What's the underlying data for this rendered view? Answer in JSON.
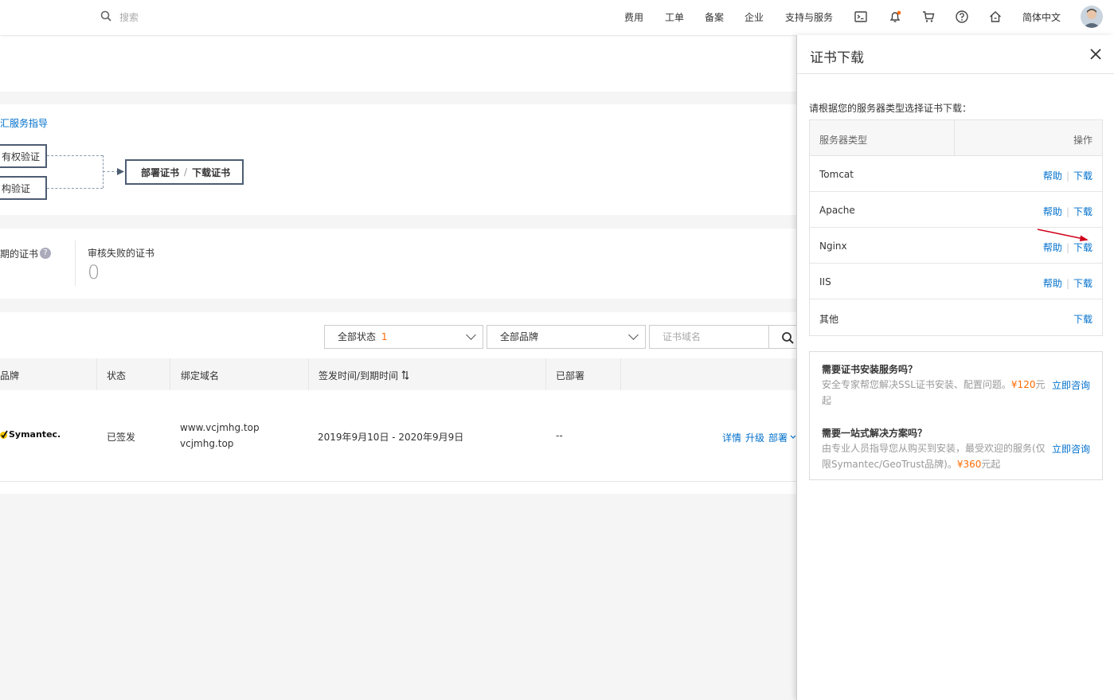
{
  "topbar": {
    "search_placeholder": "搜索",
    "nav": [
      "费用",
      "工单",
      "备案",
      "企业",
      "支持与服务"
    ],
    "language": "简体中文",
    "icons": [
      "terminal-icon",
      "bell-icon",
      "cart-icon",
      "help-circle-icon",
      "home-icon"
    ]
  },
  "guide": {
    "link": "汇服务指导",
    "box_ownership": "有权验证",
    "box_org": "构验证",
    "box_deploy": "部署证书",
    "box_download": "下载证书"
  },
  "stats": {
    "expired_label": "期的证书",
    "failed_label": "审核失败的证书",
    "failed_count": "0"
  },
  "filters": {
    "status_label": "全部状态",
    "status_count": "1",
    "brand_label": "全部品牌",
    "domain_placeholder": "证书域名"
  },
  "table": {
    "headers": [
      "品牌",
      "状态",
      "绑定域名",
      "签发时间/到期时间",
      "已部署"
    ],
    "rows": [
      {
        "brand": "Symantec.",
        "status": "已签发",
        "domains": [
          "www.vcjmhg.top",
          "vcjmhg.top"
        ],
        "period": "2019年9月10日 - 2020年9月9日",
        "deployed": "--",
        "actions": [
          "详情",
          "升级",
          "部署"
        ]
      }
    ]
  },
  "panel": {
    "title": "证书下载",
    "intro": "请根据您的服务器类型选择证书下载：",
    "col_server": "服务器类型",
    "col_action": "操作",
    "help_label": "帮助",
    "download_label": "下载",
    "servers": [
      {
        "name": "Tomcat",
        "has_help": true
      },
      {
        "name": "Apache",
        "has_help": true
      },
      {
        "name": "Nginx",
        "has_help": true
      },
      {
        "name": "IIS",
        "has_help": true
      },
      {
        "name": "其他",
        "has_help": false
      }
    ],
    "promo1": {
      "title": "需要证书安装服务吗？",
      "desc_a": "安全专家帮您解决SSL证书安装、配置问题。",
      "price": "¥120",
      "desc_b": "元起",
      "link": "立即咨询"
    },
    "promo2": {
      "title": "需要一站式解决方案吗？",
      "desc_a": "由专业人员指导您从购买到安装，最受欢迎的服务(仅限Symantec/GeoTrust品牌)。",
      "price": "¥360",
      "desc_b": "元起",
      "link": "立即咨询"
    }
  },
  "colors": {
    "link_blue": "#0070cc",
    "price_orange": "#ff6a00",
    "annotation_arrow": "#d0021b"
  }
}
